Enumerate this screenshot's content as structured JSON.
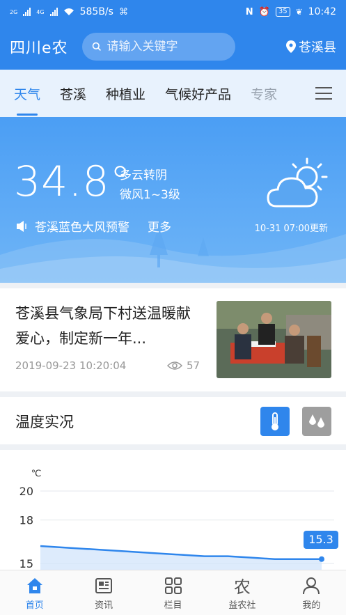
{
  "status_bar": {
    "network_1": "2G",
    "network_2": "4G",
    "speed": "585B/s",
    "battery": "35",
    "time": "10:42"
  },
  "header": {
    "logo": "四川e农",
    "search_placeholder": "请输入关键字",
    "location": "苍溪县"
  },
  "tabs": [
    {
      "label": "天气"
    },
    {
      "label": "苍溪"
    },
    {
      "label": "种植业"
    },
    {
      "label": "气候好产品"
    },
    {
      "label": "专家"
    }
  ],
  "weather": {
    "temperature": "34.8°",
    "condition": "多云转阴",
    "wind": "微风1~3级",
    "alert": "苍溪蓝色大风预警",
    "more": "更多",
    "updated": "10-31 07:00更新"
  },
  "news": {
    "title": "苍溪县气象局下村送温暖献爱心，制定新一年...",
    "date": "2019-09-23 10:20:04",
    "views": "57"
  },
  "temperature_section": {
    "title": "温度实况"
  },
  "chart_data": {
    "type": "area",
    "unit": "℃",
    "y_ticks": [
      "20",
      "18",
      "15"
    ],
    "ylim": [
      15,
      20
    ],
    "x": [
      0,
      1,
      2,
      3,
      4,
      5,
      6,
      7,
      8,
      9,
      10,
      11,
      12
    ],
    "values": [
      16.2,
      16.1,
      16.0,
      15.9,
      15.8,
      15.7,
      15.6,
      15.5,
      15.5,
      15.4,
      15.3,
      15.3,
      15.3
    ],
    "last_label": "15.3",
    "colors": {
      "line": "#2f86ec",
      "fill": "#cfe3fb",
      "badge": "#2f86ec"
    }
  },
  "bottom_nav": [
    {
      "label": "首页",
      "icon": "home-icon",
      "active": true
    },
    {
      "label": "资讯",
      "icon": "news-icon",
      "active": false
    },
    {
      "label": "栏目",
      "icon": "grid-icon",
      "active": false
    },
    {
      "label": "益农社",
      "icon": "farm-icon",
      "glyph": "农",
      "active": false
    },
    {
      "label": "我的",
      "icon": "user-icon",
      "active": false
    }
  ],
  "colors": {
    "primary": "#2f86ec",
    "tab_bg": "#e8f2fd"
  }
}
